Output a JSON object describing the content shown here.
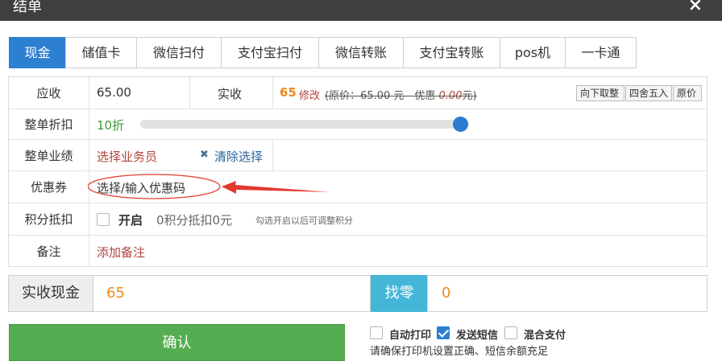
{
  "window": {
    "title": "结单",
    "close_glyph": "×"
  },
  "tabs": [
    {
      "label": "现金",
      "active": true
    },
    {
      "label": "储值卡",
      "active": false
    },
    {
      "label": "微信扫付",
      "active": false
    },
    {
      "label": "支付宝扫付",
      "active": false
    },
    {
      "label": "微信转账",
      "active": false
    },
    {
      "label": "支付宝转账",
      "active": false
    },
    {
      "label": "pos机",
      "active": false
    },
    {
      "label": "一卡通",
      "active": false
    }
  ],
  "form": {
    "receivable": {
      "label": "应收",
      "value": "65.00"
    },
    "actual": {
      "label": "实收",
      "value": "65",
      "edit": "修改",
      "original": "(原价：65.00 元 - 优惠 ",
      "discount": "0.00",
      "tail": "元)",
      "buttons": [
        "向下取整",
        "四舍五入",
        "原价"
      ]
    },
    "discount": {
      "label": "整单折扣",
      "value": "10折",
      "level_fraction": 1.0
    },
    "performance": {
      "label": "整单业绩",
      "select": "选择业务员",
      "clear_icon": "✖",
      "clear": "清除选择"
    },
    "coupon": {
      "label": "优惠券",
      "select": "选择/输入优惠码"
    },
    "points": {
      "label": "积分抵扣",
      "toggle": "开启",
      "info": "0积分抵扣0元",
      "hint": "勾选开启以后可调整积分"
    },
    "remark": {
      "label": "备注",
      "add": "添加备注"
    }
  },
  "payment": {
    "label": "实收现金",
    "amount": "65",
    "change_label": "找零",
    "change": "0"
  },
  "confirm": "确认",
  "options": [
    {
      "label": "自动打印",
      "checked": false
    },
    {
      "label": "发送短信",
      "checked": true
    },
    {
      "label": "混合支付",
      "checked": false
    }
  ],
  "notice": "请确保打印机设置正确、短信余额充足",
  "colors": {
    "accent": "#2d7fd1",
    "orange": "#f08a1b",
    "link_red": "#b0443c",
    "green": "#55ad51",
    "cyan": "#44b7d9",
    "annotation_red": "#e23a2e"
  }
}
